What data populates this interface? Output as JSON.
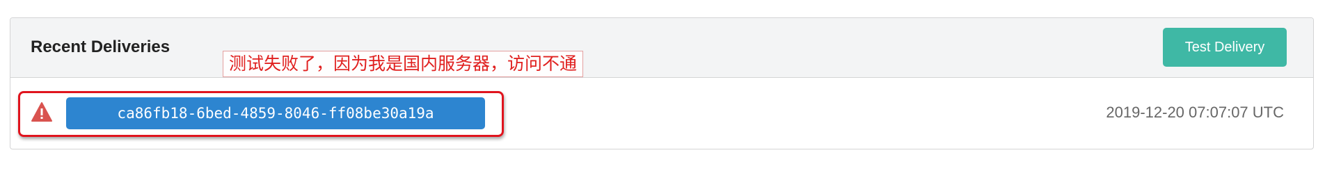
{
  "section": {
    "title": "Recent Deliveries",
    "test_button_label": "Test Delivery"
  },
  "annotation": {
    "text": "测试失败了，因为我是国内服务器，访问不通",
    "color": "#e0201f"
  },
  "deliveries": [
    {
      "status": "failed",
      "status_icon": "warning-icon",
      "status_color": "#d9534f",
      "guid": "ca86fb18-6bed-4859-8046-ff08be30a19a",
      "timestamp": "2019-12-20 07:07:07 UTC",
      "highlighted": true
    }
  ],
  "colors": {
    "accent_teal": "#3fb8a5",
    "guid_blue": "#2d85d0",
    "highlight_red": "#e0141e"
  }
}
